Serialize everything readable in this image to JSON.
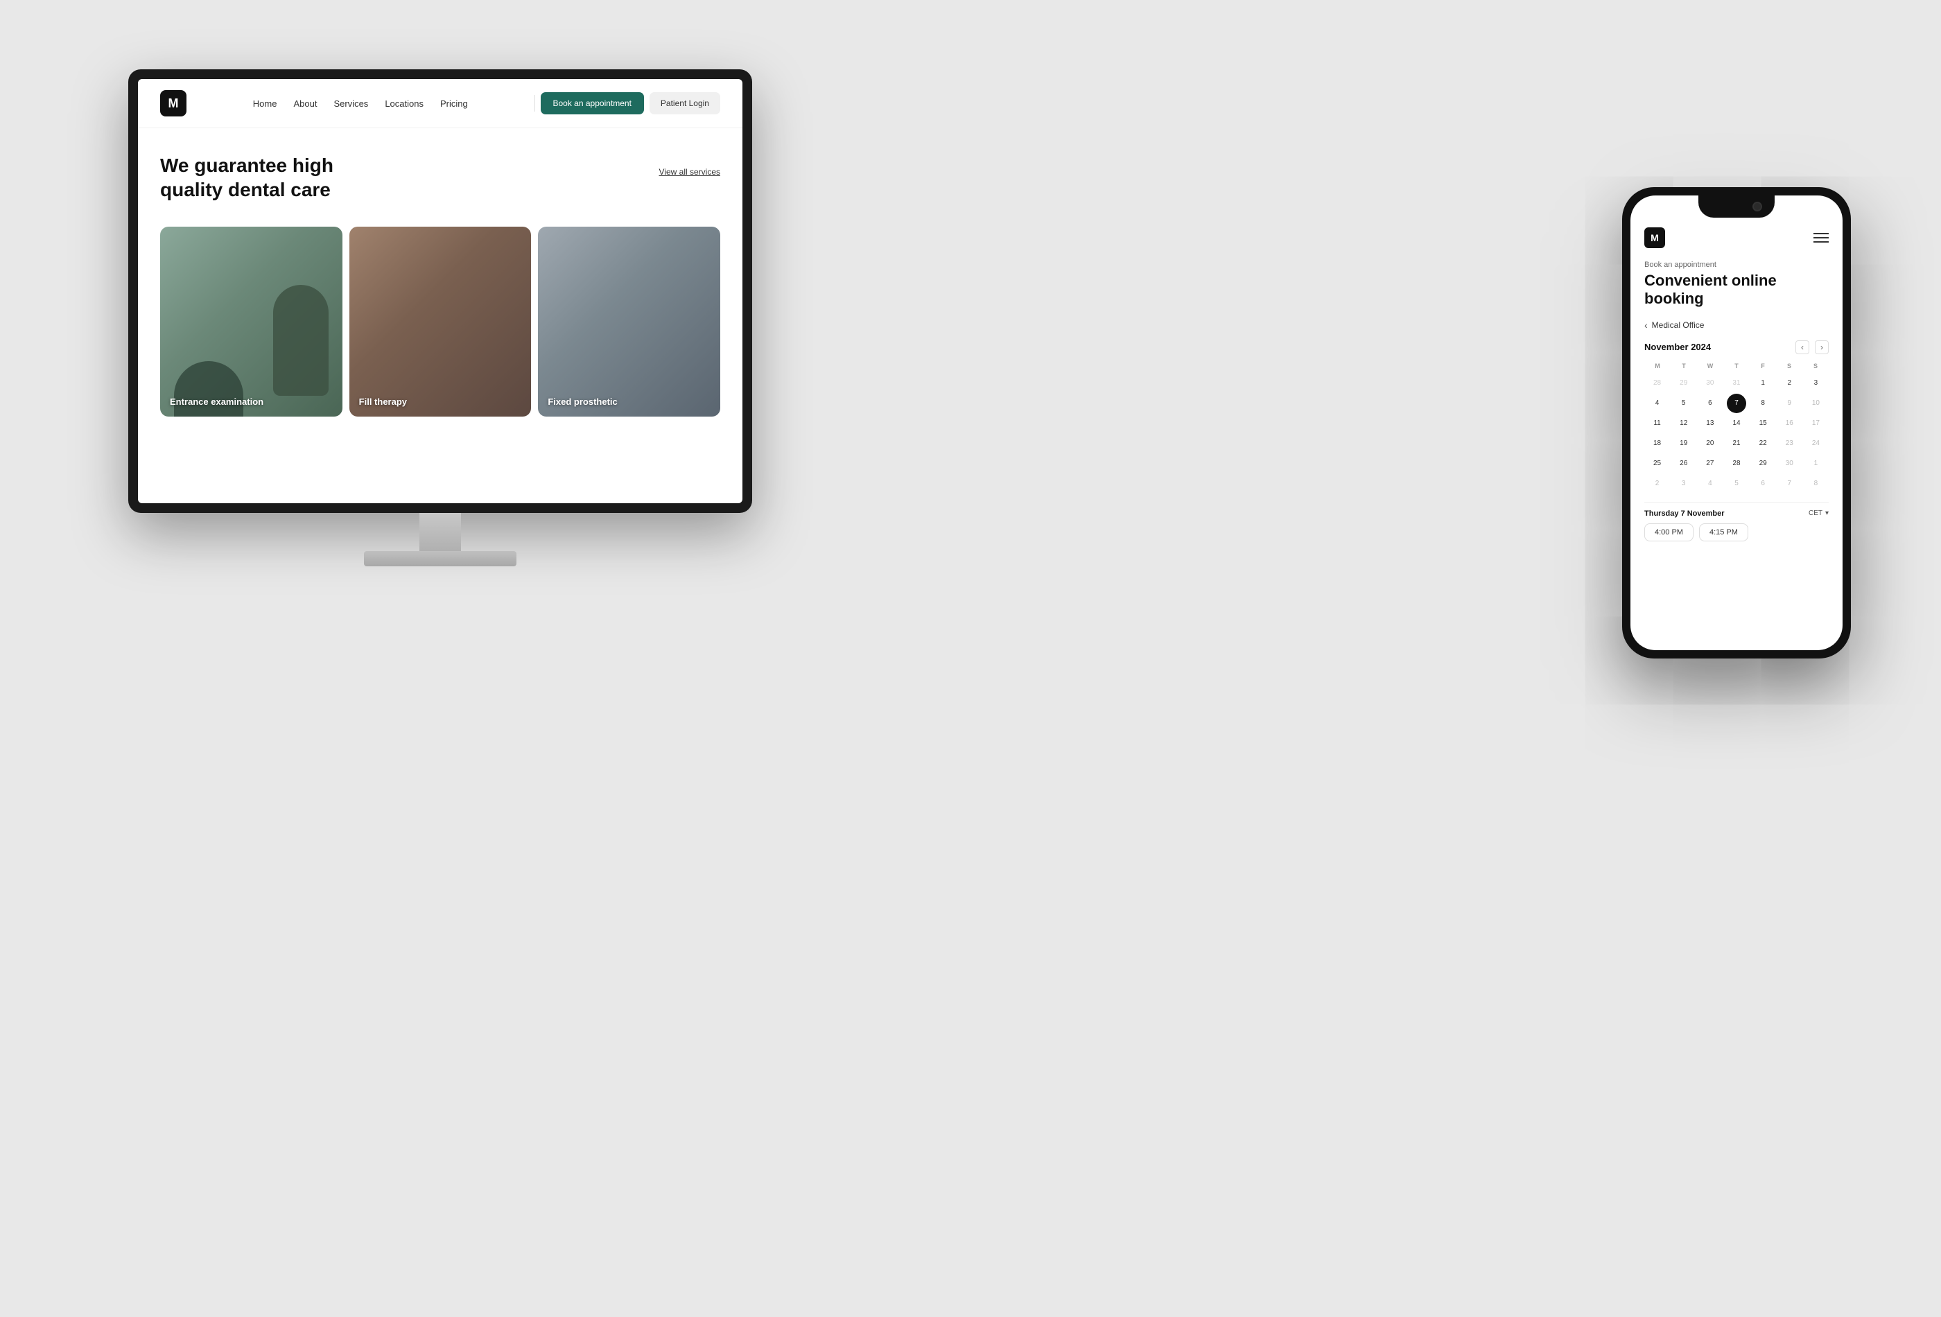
{
  "page": {
    "background_color": "#e8e8e8"
  },
  "website": {
    "logo_text": "M",
    "nav": {
      "links": [
        {
          "label": "Home",
          "id": "home"
        },
        {
          "label": "About",
          "id": "about"
        },
        {
          "label": "Services",
          "id": "services"
        },
        {
          "label": "Locations",
          "id": "locations"
        },
        {
          "label": "Pricing",
          "id": "pricing"
        }
      ],
      "cta_book": "Book an appointment",
      "cta_patient": "Patient Login"
    },
    "hero": {
      "title_line1": "We guarantee high",
      "title_line2": "quality dental care",
      "view_all": "View all services"
    },
    "service_cards": [
      {
        "label": "Entrance examination",
        "style": "dental"
      },
      {
        "label": "Fill therapy",
        "style": "therapy"
      },
      {
        "label": "Fixed prosthetic",
        "style": "prosthetic"
      }
    ]
  },
  "phone": {
    "logo_text": "M",
    "booking_label": "Book an appointment",
    "main_title_line1": "Convenient online",
    "main_title_line2": "booking",
    "back_nav_label": "Medical Office",
    "calendar": {
      "month": "November 2024",
      "day_labels": [
        "M",
        "T",
        "W",
        "T",
        "F",
        "S",
        "S"
      ],
      "weeks": [
        [
          {
            "num": "28",
            "muted": true
          },
          {
            "num": "29",
            "muted": true
          },
          {
            "num": "30",
            "muted": true
          },
          {
            "num": "31",
            "muted": true
          },
          {
            "num": "1",
            "muted": false
          },
          {
            "num": "2",
            "muted": false
          },
          {
            "num": "3",
            "muted": false
          }
        ],
        [
          {
            "num": "4",
            "muted": false
          },
          {
            "num": "5",
            "muted": false
          },
          {
            "num": "6",
            "muted": false
          },
          {
            "num": "7",
            "selected": true
          },
          {
            "num": "8",
            "muted": false
          },
          {
            "num": "9",
            "dimmed": true
          },
          {
            "num": "10",
            "dimmed": true
          }
        ],
        [
          {
            "num": "11",
            "muted": false
          },
          {
            "num": "12",
            "muted": false
          },
          {
            "num": "13",
            "muted": false
          },
          {
            "num": "14",
            "muted": false
          },
          {
            "num": "15",
            "muted": false
          },
          {
            "num": "16",
            "dimmed": true
          },
          {
            "num": "17",
            "dimmed": true
          }
        ],
        [
          {
            "num": "18",
            "muted": false
          },
          {
            "num": "19",
            "muted": false
          },
          {
            "num": "20",
            "muted": false
          },
          {
            "num": "21",
            "muted": false
          },
          {
            "num": "22",
            "muted": false
          },
          {
            "num": "23",
            "dimmed": true
          },
          {
            "num": "24",
            "dimmed": true
          }
        ],
        [
          {
            "num": "25",
            "muted": false
          },
          {
            "num": "26",
            "muted": false
          },
          {
            "num": "27",
            "muted": false
          },
          {
            "num": "28",
            "muted": false
          },
          {
            "num": "29",
            "muted": false
          },
          {
            "num": "30",
            "dimmed": true
          },
          {
            "num": "1",
            "dimmed": true
          }
        ],
        [
          {
            "num": "2",
            "dimmed": true
          },
          {
            "num": "3",
            "dimmed": true
          },
          {
            "num": "4",
            "dimmed": true
          },
          {
            "num": "5",
            "dimmed": true
          },
          {
            "num": "6",
            "dimmed": true
          },
          {
            "num": "7",
            "dimmed": true
          },
          {
            "num": "8",
            "dimmed": true
          }
        ]
      ]
    },
    "time_section": {
      "date_label": "Thursday 7 November",
      "timezone": "CET",
      "slots": [
        "4:00 PM",
        "4:15 PM"
      ]
    }
  }
}
